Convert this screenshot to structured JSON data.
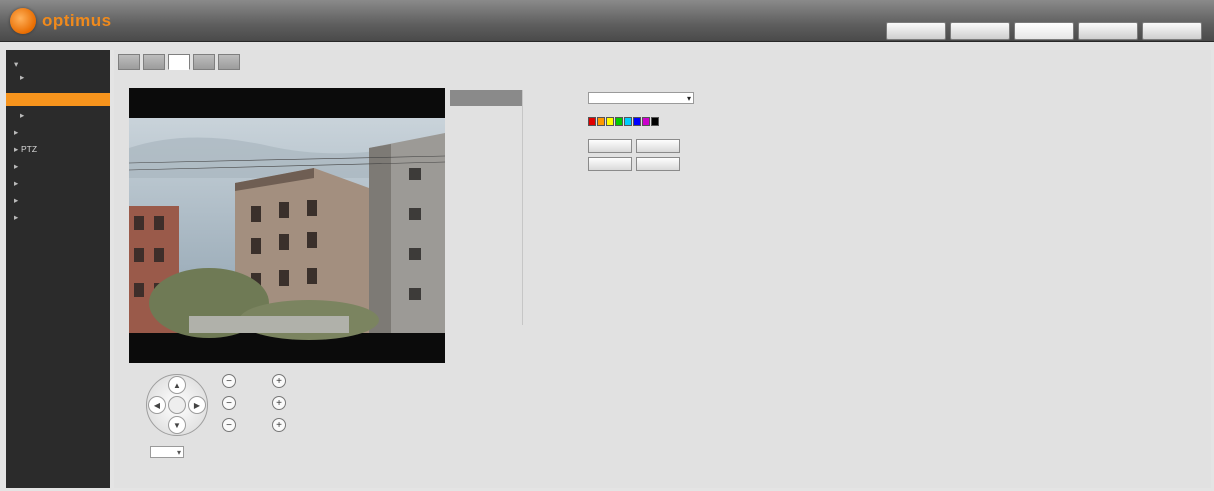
{
  "header": {
    "logo_text": "optimus",
    "nav": [
      {
        "label": ""
      },
      {
        "label": ""
      },
      {
        "label": ""
      },
      {
        "label": ""
      },
      {
        "label": ""
      }
    ],
    "active_nav_index": 2
  },
  "sidebar": {
    "items": [
      {
        "label": "",
        "level": 0
      },
      {
        "label": "",
        "level": 1
      },
      {
        "label": "",
        "level": 2,
        "selected": true
      },
      {
        "label": "",
        "level": 1
      },
      {
        "label": "",
        "level": 0
      },
      {
        "label": "PTZ",
        "level": 0
      },
      {
        "label": "",
        "level": 0
      },
      {
        "label": "",
        "level": 0
      },
      {
        "label": "",
        "level": 0
      },
      {
        "label": "",
        "level": 0
      }
    ]
  },
  "tabs": [
    {
      "label": ""
    },
    {
      "label": ""
    },
    {
      "label": ""
    },
    {
      "label": ""
    },
    {
      "label": ""
    }
  ],
  "active_tab_index": 2,
  "overlay_menu": [
    {
      "label": "",
      "selected": true
    },
    {
      "label": ""
    },
    {
      "label": ""
    },
    {
      "label": ""
    },
    {
      "label": ""
    },
    {
      "label": ""
    },
    {
      "label": ""
    }
  ],
  "settings": {
    "row1_label": "",
    "row1_value": "",
    "row2_label": "",
    "colors": [
      "#e00000",
      "#ff9900",
      "#ffff00",
      "#00cc00",
      "#00ccff",
      "#0000ff",
      "#cc00cc",
      "#000000"
    ],
    "buttons": [
      {
        "label": ""
      },
      {
        "label": ""
      },
      {
        "label": ""
      },
      {
        "label": ""
      }
    ]
  },
  "ptz": {
    "zoom_label": "",
    "focus_label": "",
    "iris_label": "",
    "speed_label": "",
    "speed_value": "",
    "arrows": {
      "up": "▲",
      "down": "▼",
      "left": "◀",
      "right": "▶"
    },
    "minus": "−",
    "plus": "+"
  },
  "icons": {
    "select_arrow": "▾"
  }
}
